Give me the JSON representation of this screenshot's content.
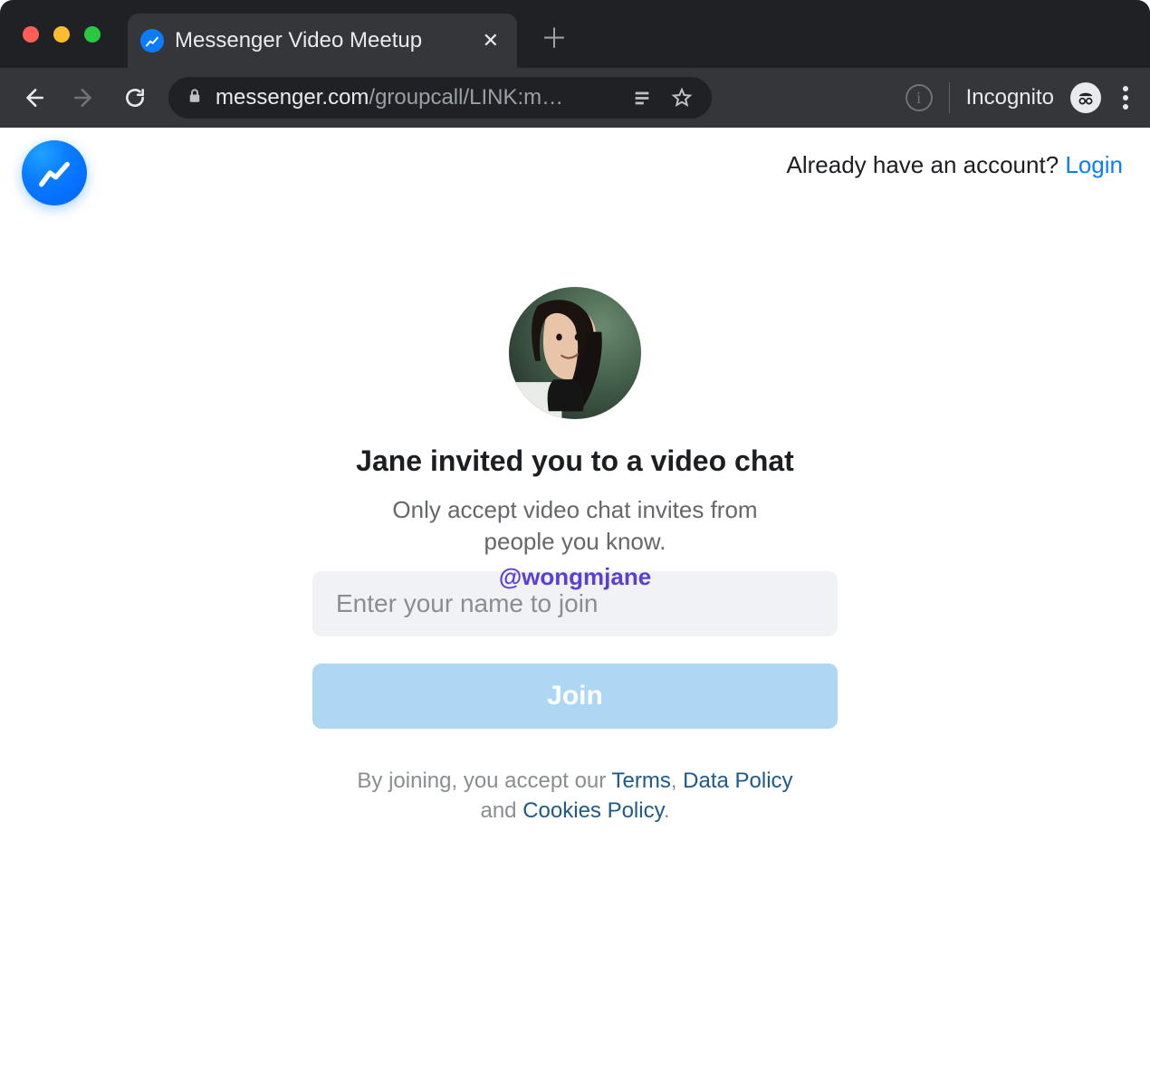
{
  "browser": {
    "tab_title": "Messenger Video Meetup",
    "url_host": "messenger.com",
    "url_path": "/groupcall/LINK:m…",
    "incognito_label": "Incognito"
  },
  "header": {
    "account_prompt": "Already have an account? ",
    "login_label": "Login"
  },
  "card": {
    "heading": "Jane invited you to a video chat",
    "subtext": "Only accept video chat invites from people you know.",
    "watermark": "@wongmjane",
    "name_placeholder": "Enter your name to join",
    "join_label": "Join"
  },
  "legal": {
    "prefix": "By joining, you accept our ",
    "terms": "Terms",
    "sep1": ", ",
    "data_policy": "Data Policy",
    "sep2": " and ",
    "cookies_policy": "Cookies Policy",
    "suffix": "."
  }
}
